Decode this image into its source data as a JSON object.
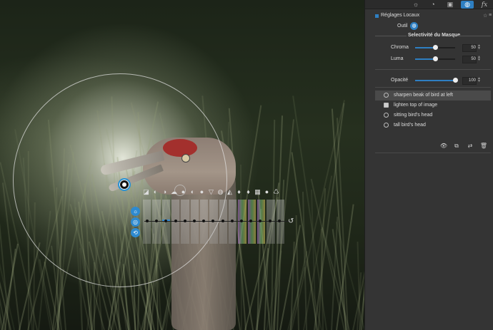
{
  "panel": {
    "tabs": [
      {
        "icon": "sun-icon"
      },
      {
        "icon": "color-icon"
      },
      {
        "icon": "details-icon"
      },
      {
        "icon": "local-adjustments-icon",
        "active": true
      },
      {
        "icon": "fx-icon",
        "label": "fx"
      }
    ],
    "section_title": "Réglages Locaux",
    "tool_label": "Outil",
    "mask_selectivity_title": "Selectivité du Masque",
    "sliders": [
      {
        "label": "Chroma",
        "value": "50",
        "fraction": 0.5
      },
      {
        "label": "Luma",
        "value": "50",
        "fraction": 0.5
      }
    ],
    "opacity": {
      "label": "Opacité",
      "value": "100",
      "fraction": 1.0
    },
    "masks": [
      {
        "label": "sharpen beak of bird at left",
        "icon": "control-point-icon",
        "selected": true
      },
      {
        "label": "lighten top of image",
        "icon": "graduated-filter-icon",
        "selected": false
      },
      {
        "label": "sitting bird's head",
        "icon": "control-point-icon",
        "selected": false
      },
      {
        "label": "tall bird's head",
        "icon": "control-point-icon",
        "selected": false
      }
    ],
    "bottom_actions": [
      "show-mask-icon",
      "duplicate-icon",
      "swap-icon",
      "delete-icon"
    ]
  },
  "canvas": {
    "side_buttons": [
      "light-icon",
      "color-wheel-icon",
      "reset-icon"
    ],
    "toolbar_icons": [
      "exposure-icon",
      "contrast-icon",
      "halftone-icon",
      "cloud-icon",
      "circle-icon",
      "contrast-half-icon",
      "dark-circle-icon",
      "triangle-icon",
      "gray-circle-icon",
      "vibrance-icon",
      "drop-icon",
      "drop2-icon",
      "levels-icon",
      "dot-icon",
      "recycle-icon"
    ],
    "strip_count": 15
  },
  "colors": {
    "accent": "#2e7fc2",
    "panel_bg": "#343434"
  }
}
